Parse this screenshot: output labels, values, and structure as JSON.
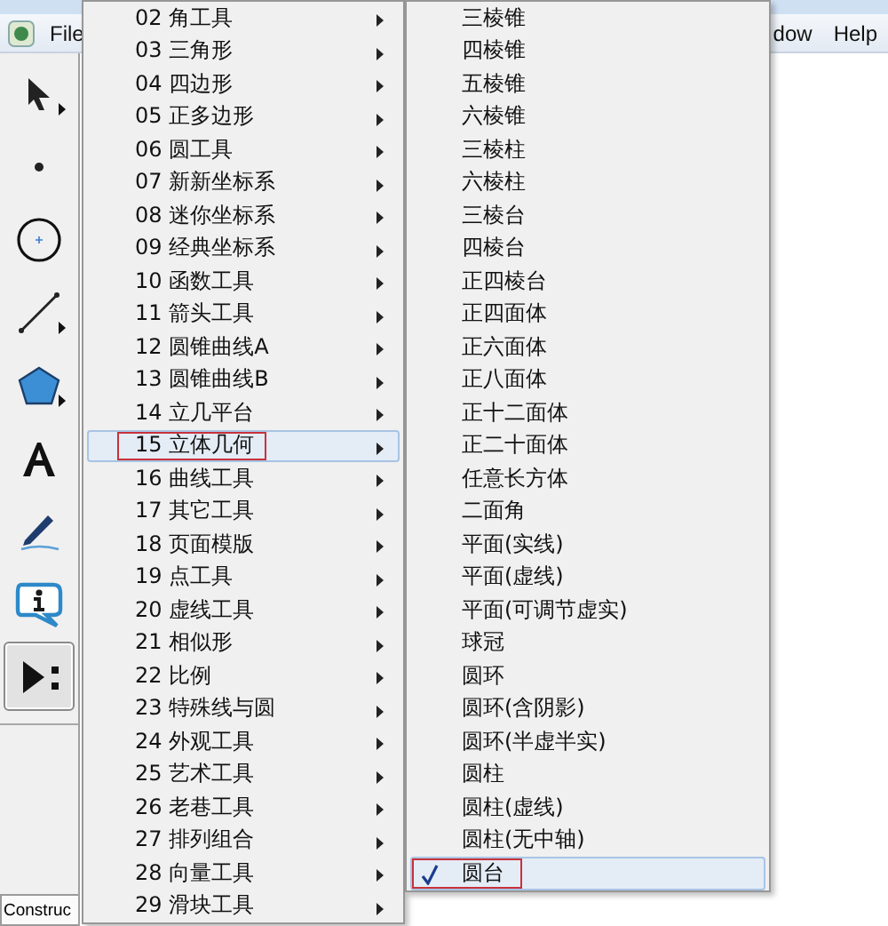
{
  "menubar": {
    "left": [
      {
        "label": "File"
      }
    ],
    "right": [
      {
        "label": "dow"
      },
      {
        "label": "Help"
      }
    ]
  },
  "toolbar": {
    "tools": [
      {
        "kind": "arrow",
        "more": true,
        "selected": false
      },
      {
        "kind": "point",
        "more": false,
        "selected": false
      },
      {
        "kind": "compass",
        "more": false,
        "selected": false
      },
      {
        "kind": "line",
        "more": true,
        "selected": false
      },
      {
        "kind": "polygon",
        "more": true,
        "selected": false
      },
      {
        "kind": "text",
        "more": false,
        "selected": false
      },
      {
        "kind": "marker",
        "more": false,
        "selected": false
      },
      {
        "kind": "info",
        "more": false,
        "selected": false
      },
      {
        "kind": "custom",
        "more": false,
        "selected": true
      }
    ]
  },
  "status_tab": "Construc",
  "menu": {
    "items": [
      {
        "label": "02 角工具",
        "selected": false
      },
      {
        "label": "03 三角形",
        "selected": false
      },
      {
        "label": "04 四边形",
        "selected": false
      },
      {
        "label": "05 正多边形",
        "selected": false
      },
      {
        "label": "06 圆工具",
        "selected": false
      },
      {
        "label": "07 新新坐标系",
        "selected": false
      },
      {
        "label": "08 迷你坐标系",
        "selected": false
      },
      {
        "label": "09 经典坐标系",
        "selected": false
      },
      {
        "label": "10 函数工具",
        "selected": false
      },
      {
        "label": "11 箭头工具",
        "selected": false
      },
      {
        "label": "12 圆锥曲线A",
        "selected": false
      },
      {
        "label": "13 圆锥曲线B",
        "selected": false
      },
      {
        "label": "14 立几平台",
        "selected": false
      },
      {
        "label": "15 立体几何",
        "selected": true
      },
      {
        "label": "16 曲线工具",
        "selected": false
      },
      {
        "label": "17 其它工具",
        "selected": false
      },
      {
        "label": "18 页面模版",
        "selected": false
      },
      {
        "label": "19 点工具",
        "selected": false
      },
      {
        "label": "20 虚线工具",
        "selected": false
      },
      {
        "label": "21 相似形",
        "selected": false
      },
      {
        "label": "22 比例",
        "selected": false
      },
      {
        "label": "23 特殊线与圆",
        "selected": false
      },
      {
        "label": "24 外观工具",
        "selected": false
      },
      {
        "label": "25 艺术工具",
        "selected": false
      },
      {
        "label": "26 老巷工具",
        "selected": false
      },
      {
        "label": "27 排列组合",
        "selected": false
      },
      {
        "label": "28 向量工具",
        "selected": false
      },
      {
        "label": "29 滑块工具",
        "selected": false
      }
    ]
  },
  "submenu": {
    "items": [
      {
        "label": "三棱锥",
        "checked": false,
        "selected": false
      },
      {
        "label": "四棱锥",
        "checked": false,
        "selected": false
      },
      {
        "label": "五棱锥",
        "checked": false,
        "selected": false
      },
      {
        "label": "六棱锥",
        "checked": false,
        "selected": false
      },
      {
        "label": "三棱柱",
        "checked": false,
        "selected": false
      },
      {
        "label": "六棱柱",
        "checked": false,
        "selected": false
      },
      {
        "label": "三棱台",
        "checked": false,
        "selected": false
      },
      {
        "label": "四棱台",
        "checked": false,
        "selected": false
      },
      {
        "label": "正四棱台",
        "checked": false,
        "selected": false
      },
      {
        "label": "正四面体",
        "checked": false,
        "selected": false
      },
      {
        "label": "正六面体",
        "checked": false,
        "selected": false
      },
      {
        "label": "正八面体",
        "checked": false,
        "selected": false
      },
      {
        "label": "正十二面体",
        "checked": false,
        "selected": false
      },
      {
        "label": "正二十面体",
        "checked": false,
        "selected": false
      },
      {
        "label": "任意长方体",
        "checked": false,
        "selected": false
      },
      {
        "label": "二面角",
        "checked": false,
        "selected": false
      },
      {
        "label": "平面(实线)",
        "checked": false,
        "selected": false
      },
      {
        "label": "平面(虚线)",
        "checked": false,
        "selected": false
      },
      {
        "label": "平面(可调节虚实)",
        "checked": false,
        "selected": false
      },
      {
        "label": "球冠",
        "checked": false,
        "selected": false
      },
      {
        "label": "圆环",
        "checked": false,
        "selected": false
      },
      {
        "label": "圆环(含阴影)",
        "checked": false,
        "selected": false
      },
      {
        "label": "圆环(半虚半实)",
        "checked": false,
        "selected": false
      },
      {
        "label": "圆柱",
        "checked": false,
        "selected": false
      },
      {
        "label": "圆柱(虚线)",
        "checked": false,
        "selected": false
      },
      {
        "label": "圆柱(无中轴)",
        "checked": false,
        "selected": false
      },
      {
        "label": "圆台",
        "checked": true,
        "selected": true
      }
    ]
  }
}
